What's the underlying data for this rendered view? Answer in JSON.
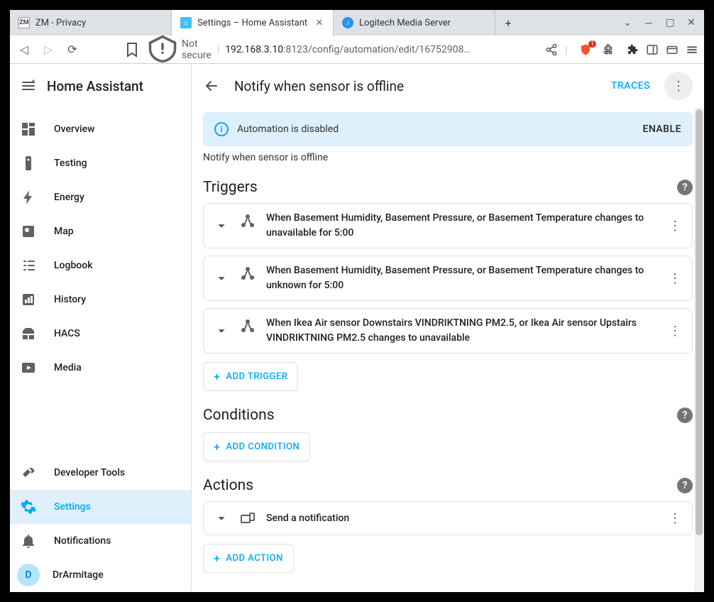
{
  "browser": {
    "tabs": [
      {
        "label": "ZM - Privacy",
        "icon": "ZM"
      },
      {
        "label": "Settings – Home Assistant",
        "icon": "ha",
        "active": true
      },
      {
        "label": "Logitech Media Server",
        "icon": "lms"
      }
    ],
    "url_not_secure": "Not secure",
    "url_prefix": "192.168.3.10",
    "url_path": ":8123/config/automation/edit/16752908…",
    "brave_count": "1"
  },
  "app": {
    "title": "Home Assistant",
    "sidebar": [
      {
        "label": "Overview",
        "icon": "dashboard"
      },
      {
        "label": "Testing",
        "icon": "remote"
      },
      {
        "label": "Energy",
        "icon": "bolt"
      },
      {
        "label": "Map",
        "icon": "map"
      },
      {
        "label": "Logbook",
        "icon": "logbook"
      },
      {
        "label": "History",
        "icon": "chart"
      },
      {
        "label": "HACS",
        "icon": "hacs"
      },
      {
        "label": "Media",
        "icon": "media"
      }
    ],
    "sidebar_bottom": [
      {
        "label": "Developer Tools",
        "icon": "hammer"
      },
      {
        "label": "Settings",
        "icon": "gear",
        "active": true
      },
      {
        "label": "Notifications",
        "icon": "bell"
      }
    ],
    "user": {
      "initial": "D",
      "name": "DrArmitage"
    }
  },
  "page": {
    "title": "Notify when sensor is offline",
    "traces": "TRACES",
    "banner": {
      "text": "Automation is disabled",
      "action": "ENABLE"
    },
    "subtitle": "Notify when sensor is offline",
    "sections": {
      "triggers": {
        "title": "Triggers",
        "items": [
          "When Basement Humidity, Basement Pressure, or Basement Temperature changes to unavailable for 5:00",
          "When Basement Humidity, Basement Pressure, or Basement Temperature changes to unknown for 5:00",
          "When Ikea Air sensor Downstairs VINDRIKTNING PM2.5, or Ikea Air sensor Upstairs VINDRIKTNING PM2.5 changes to unavailable"
        ],
        "add": "ADD TRIGGER"
      },
      "conditions": {
        "title": "Conditions",
        "add": "ADD CONDITION"
      },
      "actions": {
        "title": "Actions",
        "items": [
          "Send a notification"
        ],
        "add": "ADD ACTION"
      }
    }
  }
}
